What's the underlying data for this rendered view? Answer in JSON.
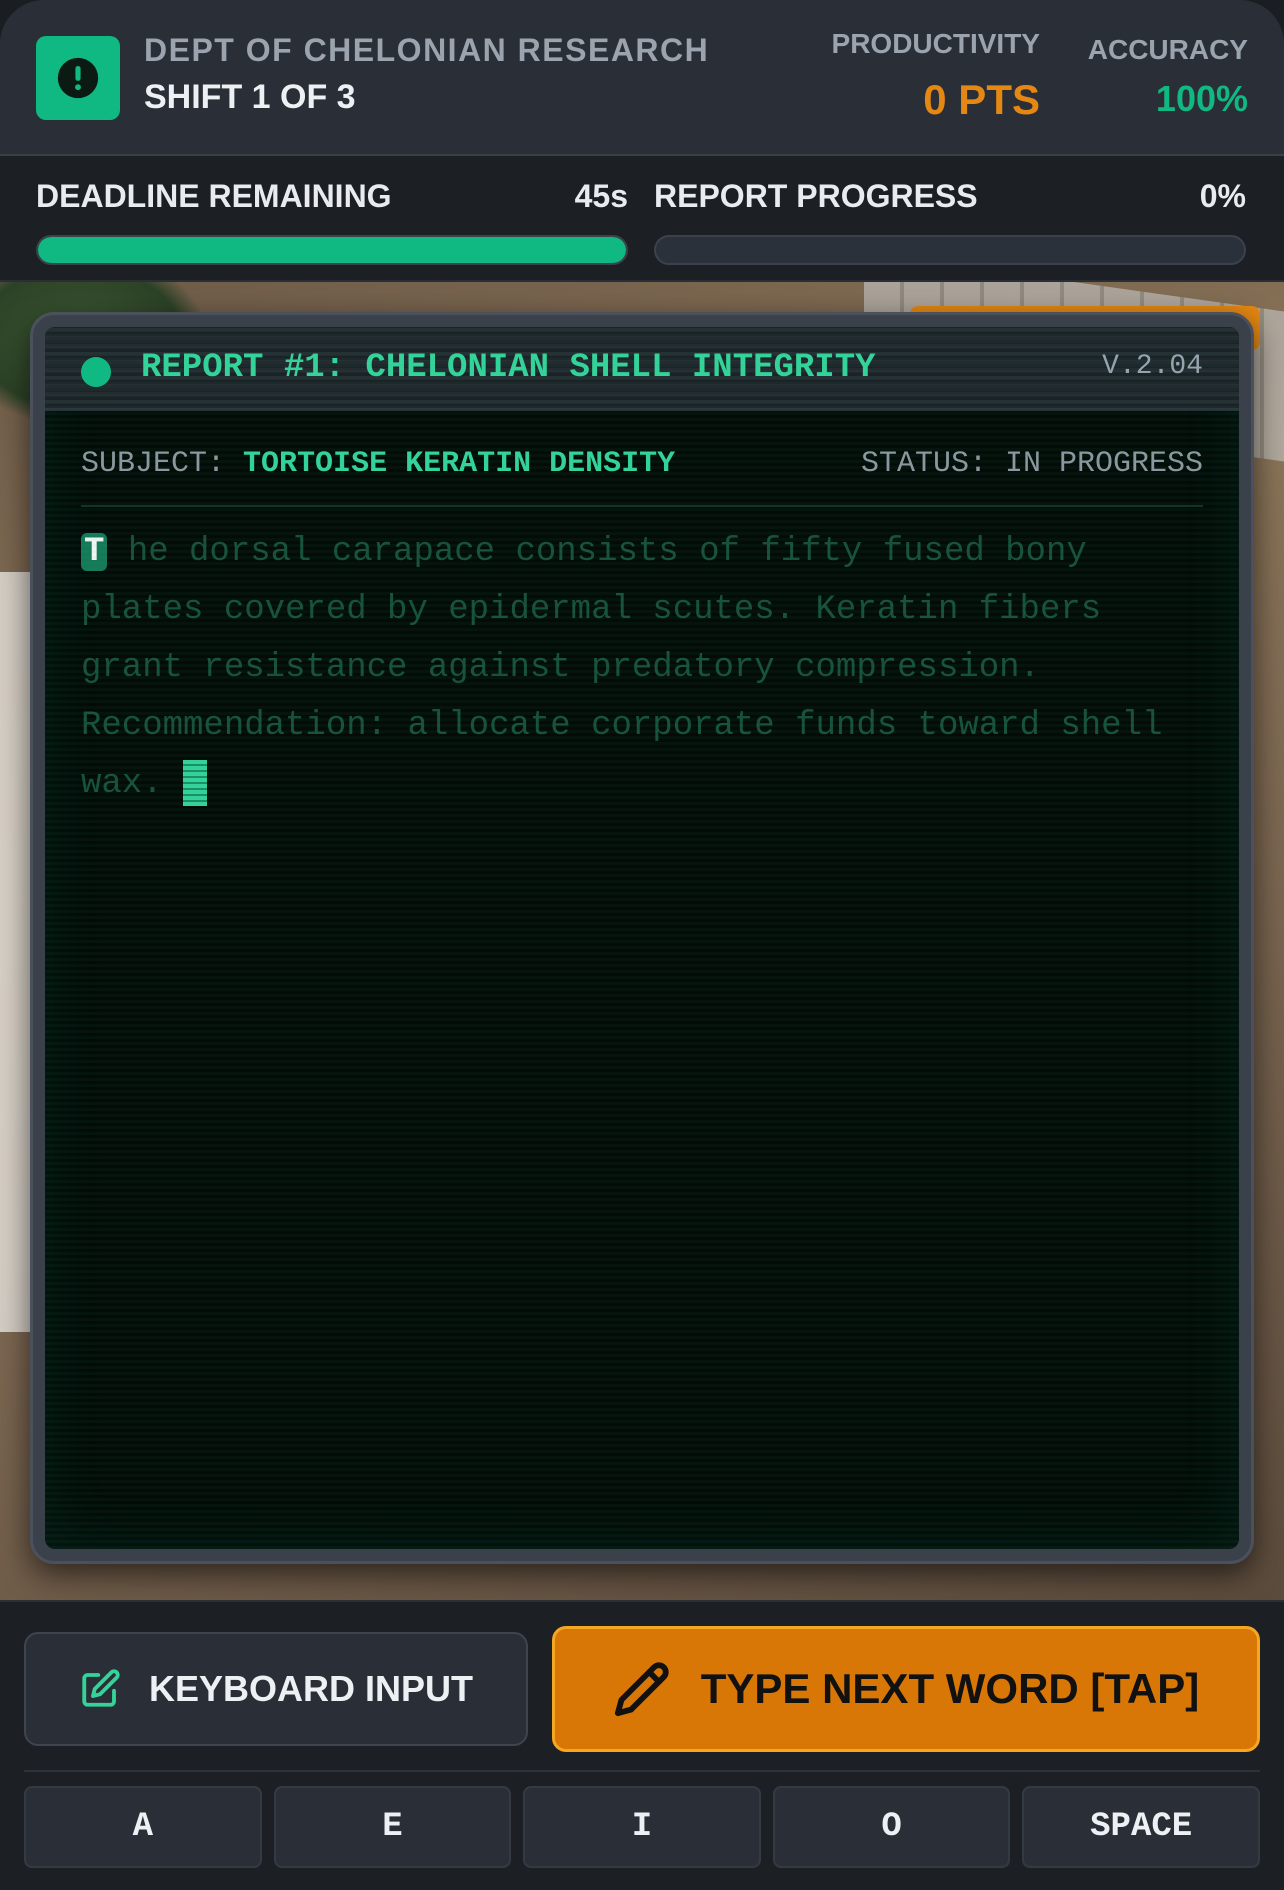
{
  "header": {
    "department": "DEPT OF CHELONIAN RESEARCH",
    "shift": "SHIFT 1 OF 3",
    "productivity_label": "PRODUCTIVITY",
    "productivity_value": "0 PTS",
    "accuracy_label": "ACCURACY",
    "accuracy_value": "100%",
    "icon": "alert-icon"
  },
  "status": {
    "deadline_label": "DEADLINE REMAINING",
    "deadline_value": "45s",
    "deadline_fraction": 1.0,
    "progress_label": "REPORT PROGRESS",
    "progress_value": "0%",
    "progress_fraction": 0.0
  },
  "terminal": {
    "title": "REPORT #1: CHELONIAN SHELL INTEGRITY",
    "version": "V.2.04",
    "subject_key": "SUBJECT:",
    "subject_value": "TORTOISE KERATIN DENSITY",
    "status_text": "STATUS: IN PROGRESS",
    "current_letter": "T",
    "remaining_text": "he dorsal carapace consists of fifty fused bony plates covered by epidermal scutes. Keratin fibers grant resistance against predatory compression. Recommendation: allocate corporate funds toward shell wax. "
  },
  "controls": {
    "keyboard_label": "KEYBOARD INPUT",
    "type_label": "TYPE NEXT WORD [TAP]",
    "keys": [
      "A",
      "E",
      "I",
      "O",
      "SPACE"
    ]
  },
  "colors": {
    "accent_green": "#10b981",
    "accent_orange": "#d97706",
    "background": "#1c1f24"
  }
}
